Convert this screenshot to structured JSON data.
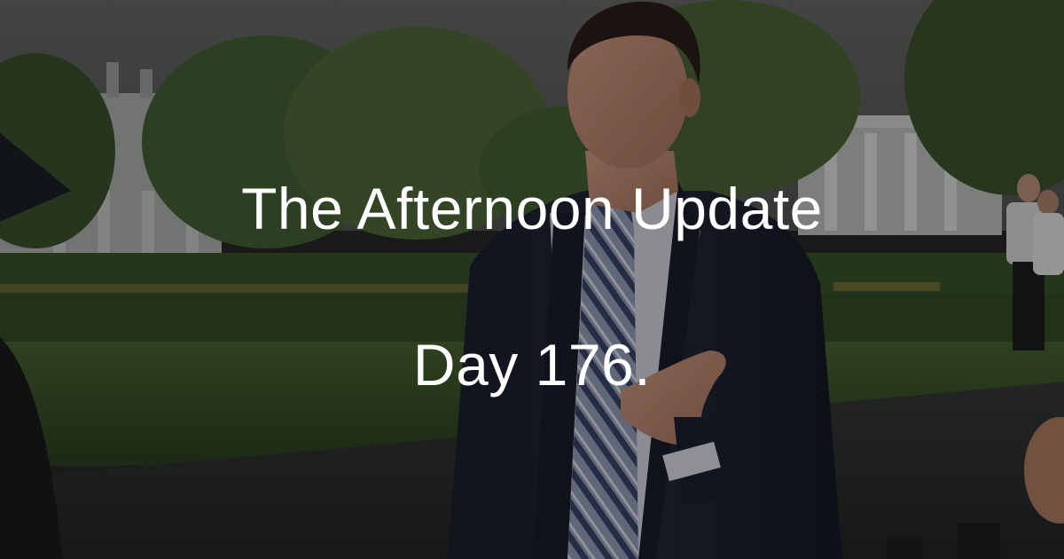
{
  "title": "The Afternoon Update",
  "subtitle": "Day 176."
}
